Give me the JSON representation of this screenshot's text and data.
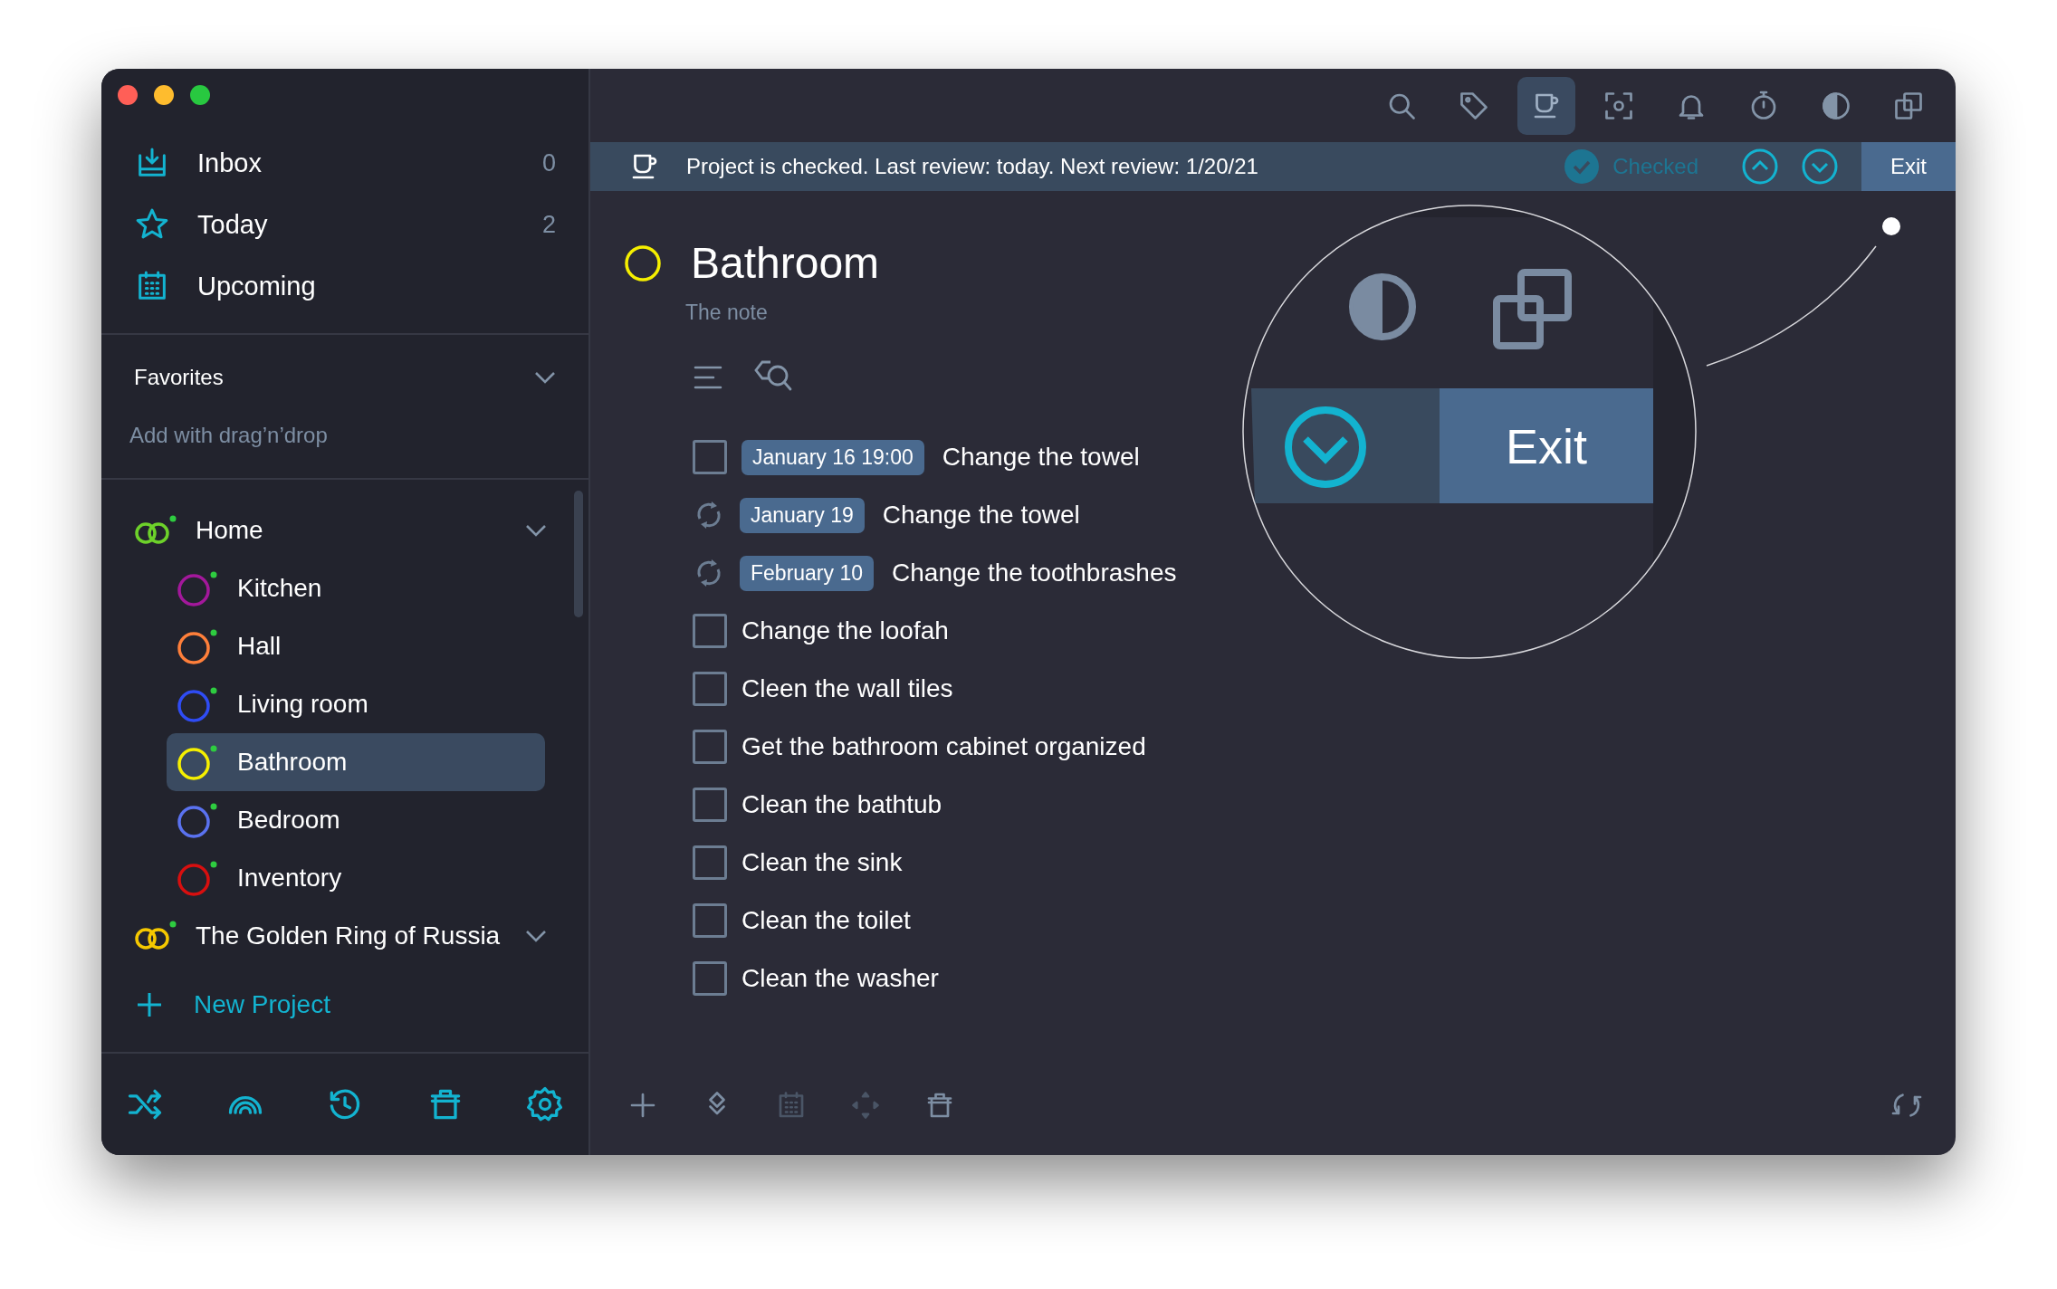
{
  "sidebar": {
    "nav": [
      {
        "kind": "inbox",
        "label": "Inbox",
        "count": "0",
        "selected": false
      },
      {
        "kind": "today",
        "label": "Today",
        "count": "2",
        "selected": false
      },
      {
        "kind": "upcoming",
        "label": "Upcoming",
        "selected": false
      }
    ],
    "favorites": {
      "title": "Favorites",
      "hint": "Add with drag’n’drop"
    },
    "projects": [
      {
        "name": "Home",
        "color": "#6dd12a",
        "selected": false,
        "children": [
          {
            "name": "Kitchen",
            "color": "#a3189b",
            "selected": false
          },
          {
            "name": "Hall",
            "color": "#ff7f3a",
            "selected": false
          },
          {
            "name": "Living room",
            "color": "#2f4cf5",
            "selected": false
          },
          {
            "name": "Bathroom",
            "color": "#f5ef00",
            "selected": true
          },
          {
            "name": "Bedroom",
            "color": "#5a72f0",
            "selected": false
          },
          {
            "name": "Inventory",
            "color": "#d80f0f",
            "selected": false
          }
        ]
      },
      {
        "name": "The Golden Ring of Russia",
        "color": "#f5c800",
        "selected": false
      }
    ],
    "new_project": "New Project",
    "footer": [
      {
        "kind": "shuffle"
      },
      {
        "kind": "rainbow"
      },
      {
        "kind": "history"
      },
      {
        "kind": "trash"
      },
      {
        "kind": "settings"
      }
    ]
  },
  "toolbar": [
    {
      "kind": "search",
      "selected": false
    },
    {
      "kind": "tag",
      "selected": false
    },
    {
      "kind": "review",
      "selected": true
    },
    {
      "kind": "focus",
      "selected": false
    },
    {
      "kind": "bell",
      "selected": false
    },
    {
      "kind": "timer",
      "selected": false
    },
    {
      "kind": "contrast",
      "selected": false
    },
    {
      "kind": "copy",
      "selected": false
    }
  ],
  "banner": {
    "text": "Project is checked. Last review: today. Next review: 1/20/21",
    "status": "Checked",
    "exit": "Exit"
  },
  "project": {
    "title": "Bathroom",
    "color": "#f5ef00",
    "note": "The note"
  },
  "tasks": [
    {
      "kind": "checkbox",
      "checked": false,
      "date": "January 16 19:00",
      "title": "Change the towel"
    },
    {
      "kind": "repeat",
      "date": "January 19",
      "title": "Change the towel"
    },
    {
      "kind": "repeat",
      "date": "February 10",
      "title": "Change the toothbrashes"
    },
    {
      "kind": "checkbox",
      "checked": false,
      "title": "Change the loofah"
    },
    {
      "kind": "checkbox",
      "checked": false,
      "title": "Cleen the wall tiles"
    },
    {
      "kind": "checkbox",
      "checked": false,
      "title": "Get the bathroom cabinet organized"
    },
    {
      "kind": "checkbox",
      "checked": false,
      "title": "Clean the bathtub"
    },
    {
      "kind": "checkbox",
      "checked": false,
      "title": "Clean the sink"
    },
    {
      "kind": "checkbox",
      "checked": false,
      "title": "Clean the toilet"
    },
    {
      "kind": "checkbox",
      "checked": false,
      "title": "Clean the washer"
    }
  ],
  "bottom_bar": [
    {
      "kind": "add",
      "disabled": false
    },
    {
      "kind": "layers",
      "disabled": false
    },
    {
      "kind": "calendar",
      "disabled": true
    },
    {
      "kind": "move",
      "disabled": true
    },
    {
      "kind": "trash",
      "disabled": false
    },
    {
      "kind": "refresh",
      "disabled": false
    }
  ],
  "magnifier": {
    "exit": "Exit"
  }
}
